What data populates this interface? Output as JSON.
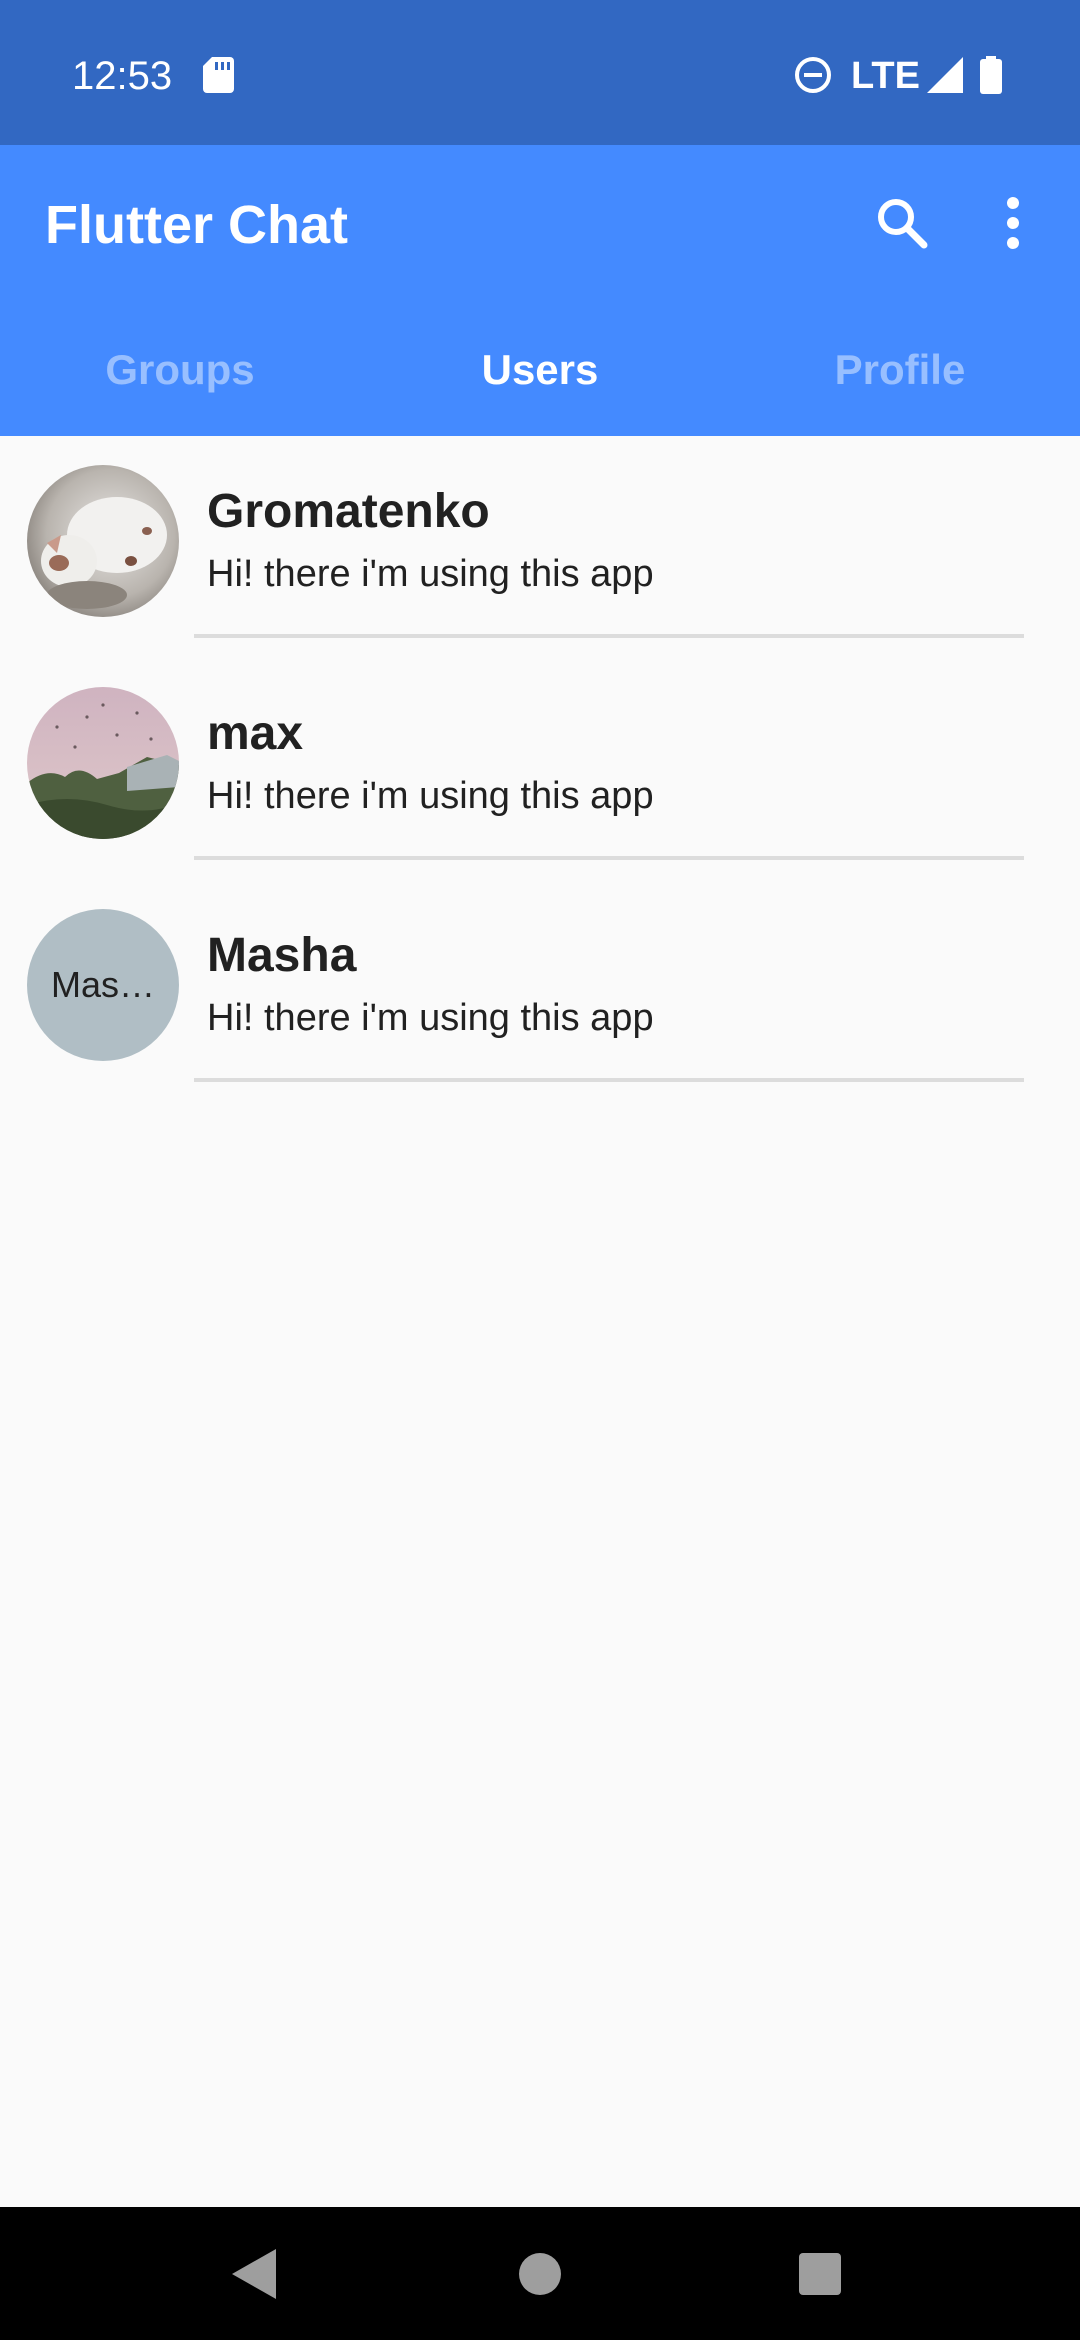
{
  "status_bar": {
    "time": "12:53",
    "network": "LTE",
    "icons": [
      "sd-card-icon",
      "do-not-disturb-icon",
      "signal-icon",
      "battery-icon"
    ]
  },
  "app_bar": {
    "title": "Flutter Chat",
    "actions": [
      "search-icon",
      "more-vert-icon"
    ],
    "background_color": "#448aff",
    "status_bar_color": "#3268c2"
  },
  "tabs": [
    {
      "label": "Groups",
      "active": false
    },
    {
      "label": "Users",
      "active": true
    },
    {
      "label": "Profile",
      "active": false
    }
  ],
  "users": [
    {
      "name": "Gromatenko",
      "status": "Hi! there i'm using this app",
      "avatar": "photo-cat"
    },
    {
      "name": "max",
      "status": "Hi! there i'm using this app",
      "avatar": "photo-landscape"
    },
    {
      "name": "Masha",
      "status": "Hi! there i'm using this app",
      "avatar_text": "Mas…"
    }
  ],
  "nav_bar": {
    "buttons": [
      "back-icon",
      "home-icon",
      "recents-icon"
    ]
  }
}
